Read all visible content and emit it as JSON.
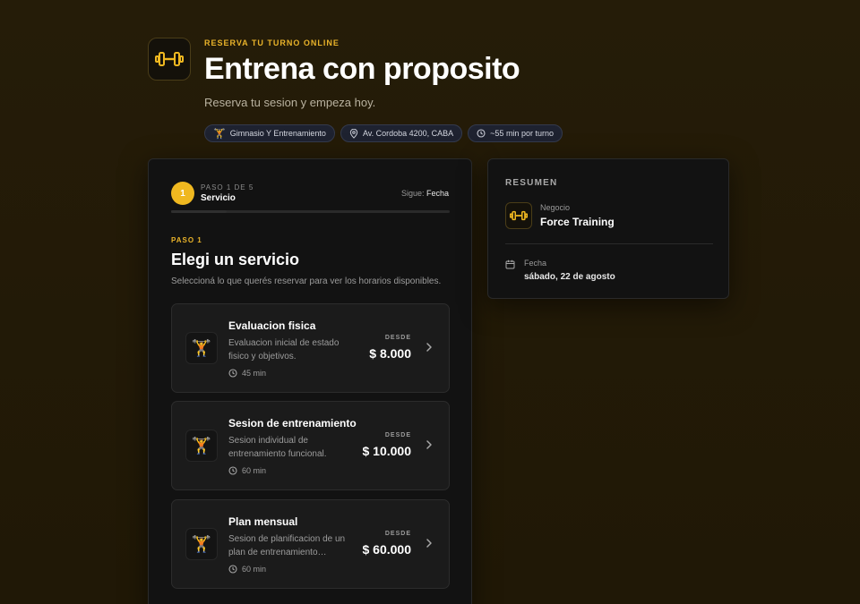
{
  "header": {
    "eyebrow": "RESERVA TU TURNO ONLINE",
    "title": "Entrena con proposito",
    "subtitle": "Reserva tu sesion y empeza hoy.",
    "chips": [
      {
        "icon": "weightlifter-icon",
        "label": "Gimnasio Y Entrenamiento"
      },
      {
        "icon": "location-pin-icon",
        "label": "Av. Cordoba 4200, CABA"
      },
      {
        "icon": "clock-icon",
        "label": "~55 min por turno"
      }
    ]
  },
  "stepper": {
    "number": "1",
    "meta": "PASO 1 DE 5",
    "name": "Servicio",
    "next_prefix": "Sigue:",
    "next_name": "Fecha",
    "progress": 0.2
  },
  "section": {
    "step_label": "PASO 1",
    "title": "Elegi un servicio",
    "description": "Seleccioná lo que querés reservar para ver los horarios disponibles."
  },
  "services": [
    {
      "name": "Evaluacion fisica",
      "description": "Evaluacion inicial de estado fisico y objetivos.",
      "duration": "45 min",
      "from_label": "DESDE",
      "price": "$ 8.000",
      "icon": "weightlifter-icon"
    },
    {
      "name": "Sesion de entrenamiento",
      "description": "Sesion individual de entrenamiento funcional.",
      "duration": "60 min",
      "from_label": "DESDE",
      "price": "$ 10.000",
      "icon": "weightlifter-icon"
    },
    {
      "name": "Plan mensual",
      "description": "Sesion de planificacion de un plan de entrenamiento…",
      "duration": "60 min",
      "from_label": "DESDE",
      "price": "$ 60.000",
      "icon": "weightlifter-icon"
    }
  ],
  "summary": {
    "title": "RESUMEN",
    "business_label": "Negocio",
    "business_name": "Force Training",
    "date_label": "Fecha",
    "date_value": "sábado, 22 de agosto"
  },
  "colors": {
    "accent": "#f0b820",
    "background": "#241b08",
    "card": "#121212"
  }
}
